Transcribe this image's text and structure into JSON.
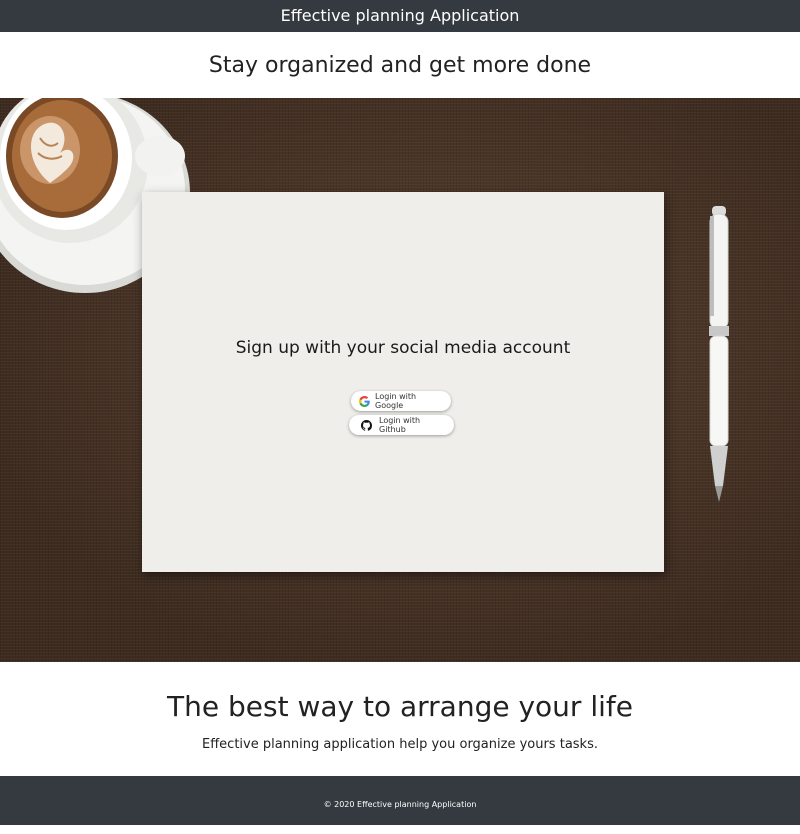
{
  "app": {
    "title": "Effective planning Application"
  },
  "hero": {
    "subtitle": "Stay organized and get more done",
    "signup_title": "Sign up with your social media account",
    "buttons": {
      "google_label": "Login with Google",
      "github_label": "Login with Github"
    }
  },
  "tagline": {
    "heading": "The best way to arrange your life",
    "text": "Effective planning application help you organize yours tasks."
  },
  "footer": {
    "copyright": "© 2020 Effective planning Application"
  },
  "icons": {
    "google": "google-logo-icon",
    "github": "github-logo-icon"
  },
  "colors": {
    "navbar": "#343a40",
    "paper": "#efeeea",
    "tablecloth": "#4a3526"
  }
}
